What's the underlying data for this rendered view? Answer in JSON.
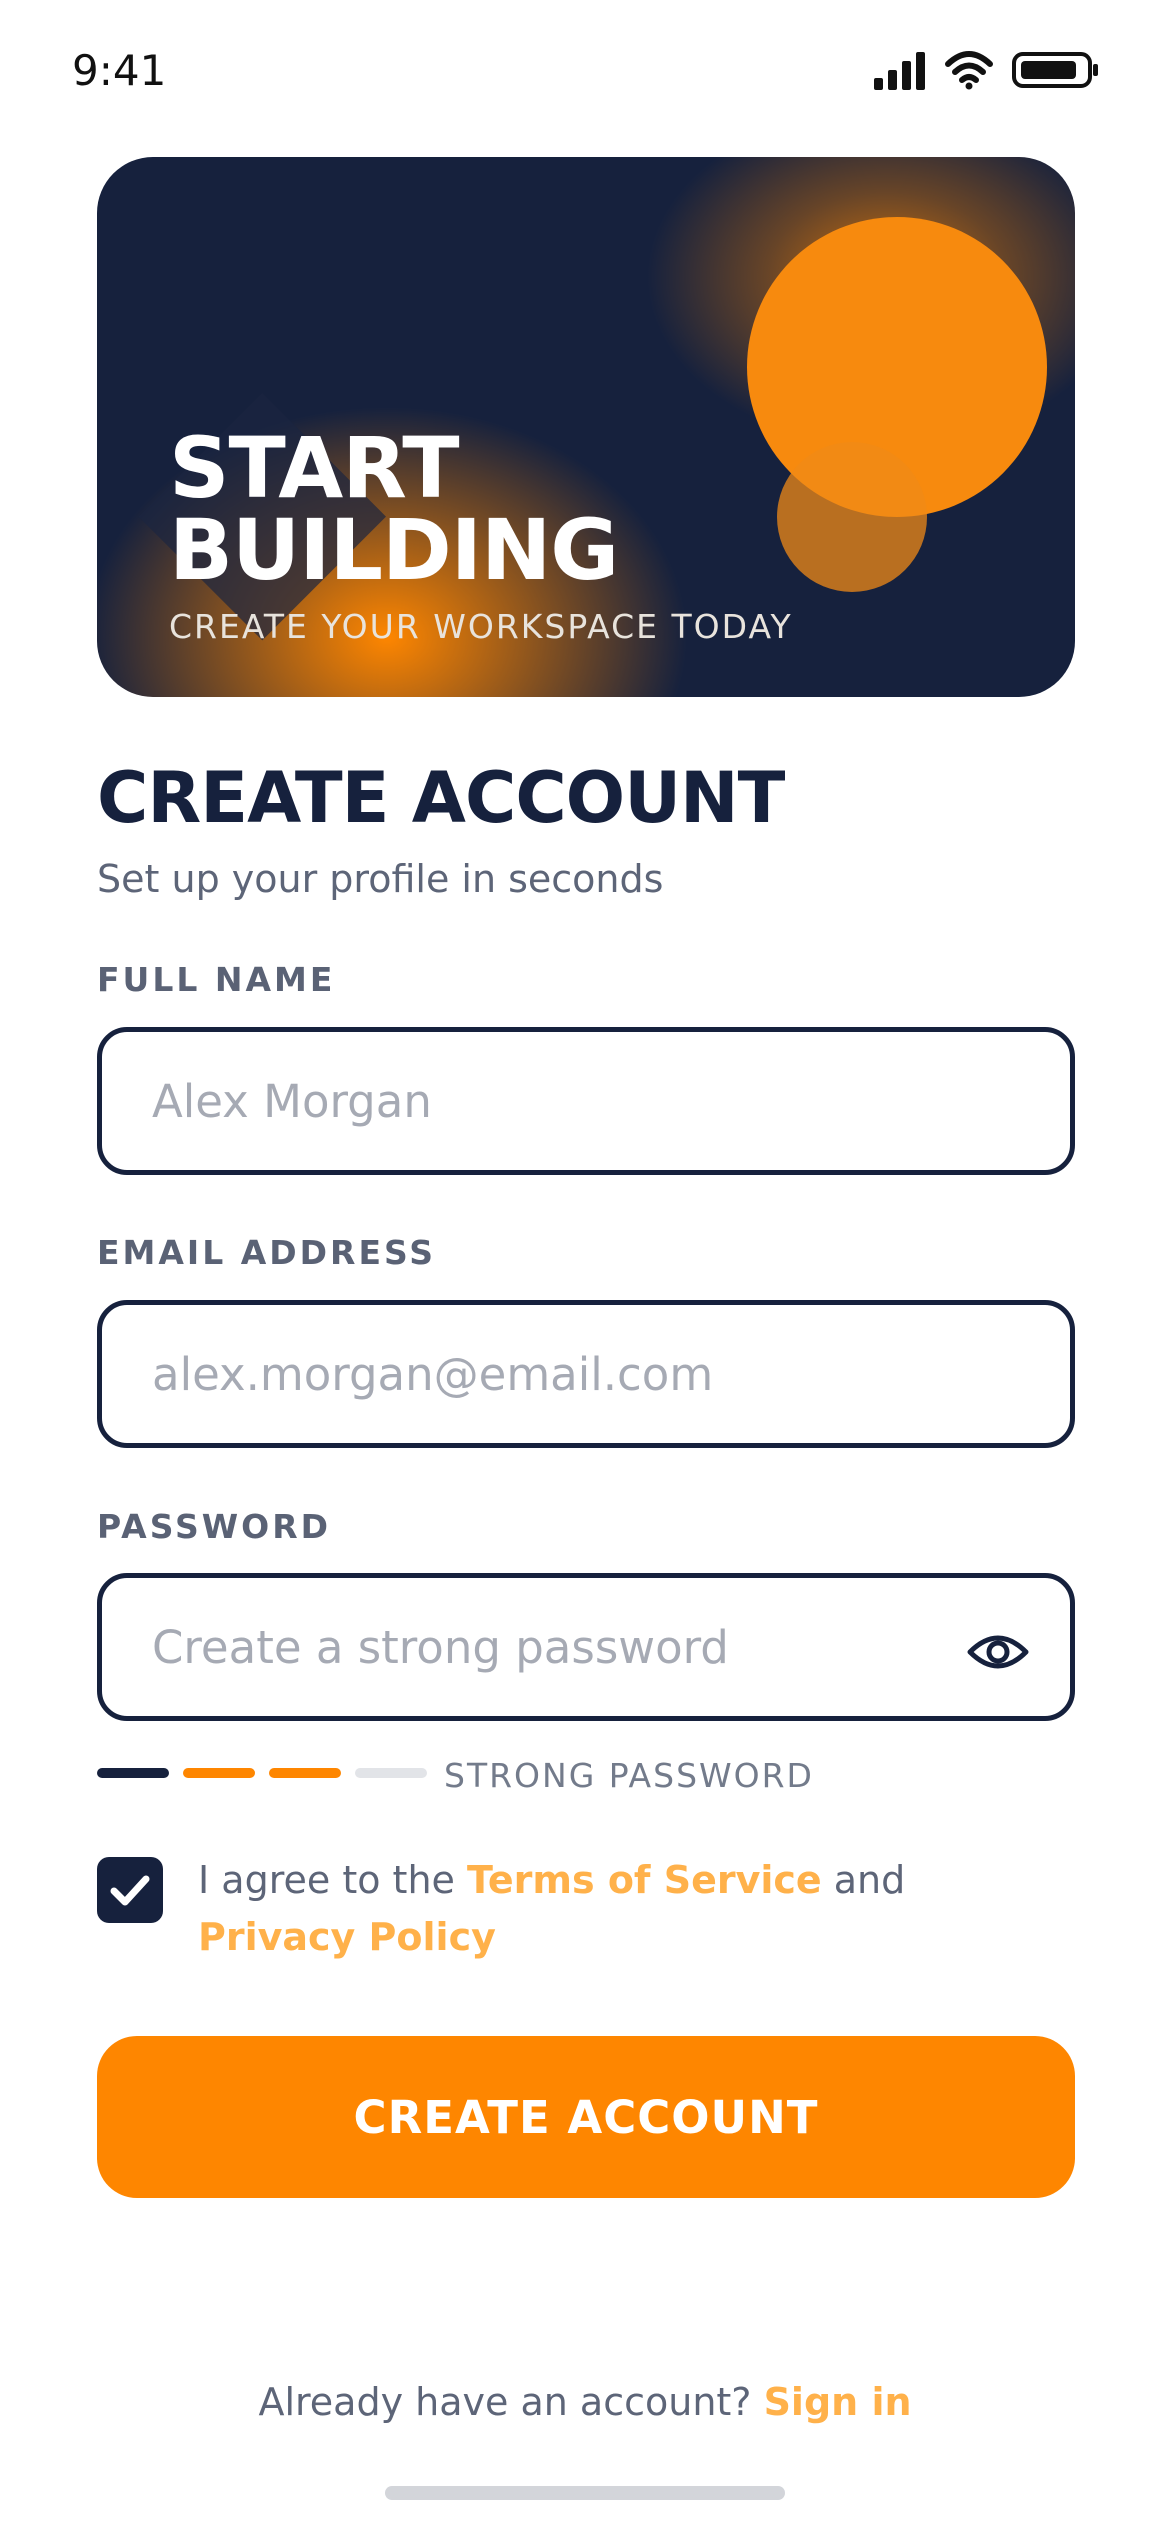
{
  "status_bar": {
    "time": "9:41"
  },
  "hero": {
    "title": "START\nBUILDING",
    "subtitle": "CREATE YOUR WORKSPACE TODAY",
    "colors": {
      "background": "#16213d",
      "accent": "#fe8600"
    }
  },
  "page": {
    "title": "CREATE ACCOUNT",
    "subtitle": "Set up your profile in seconds"
  },
  "form": {
    "full_name": {
      "label": "FULL NAME",
      "placeholder": "Alex Morgan",
      "value": ""
    },
    "email": {
      "label": "EMAIL ADDRESS",
      "placeholder": "alex.morgan@email.com",
      "value": ""
    },
    "password": {
      "label": "PASSWORD",
      "placeholder": "Create a strong password",
      "value": "",
      "toggle_icon": "eye-icon"
    },
    "strength": {
      "label": "STRONG PASSWORD",
      "level": 3,
      "total": 4,
      "colors": [
        "#16213d",
        "#fe8600",
        "#fe8600",
        "#e2e4e8"
      ]
    },
    "terms": {
      "checked": true,
      "prefix": "I agree to the ",
      "terms_link": "Terms of Service",
      "middle": " and ",
      "privacy_link": "Privacy Policy"
    },
    "submit_label": "CREATE ACCOUNT"
  },
  "footer": {
    "prompt": "Already have an account? ",
    "signin_link": "Sign in"
  },
  "colors": {
    "primary": "#16213d",
    "accent": "#fe8600",
    "link": "#ffb14a",
    "muted": "#5d6578"
  }
}
